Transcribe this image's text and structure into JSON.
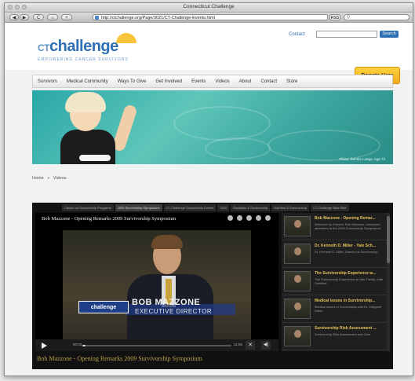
{
  "window": {
    "title": "Connecticut Challenge",
    "url": "http://ctchallenge.org/Page/3021/CT-Challenge-Events.html",
    "search_placeholder": "Q"
  },
  "toolbar": {
    "back": "◀",
    "forward": "▶",
    "reload": "C",
    "home": "⌂",
    "add": "+",
    "rss": "RSS"
  },
  "header": {
    "logo_prefix": "CT",
    "logo_main": "challenge",
    "logo_tagline": "EMPOWERING CANCER SURVIVORS",
    "contact": "Contact",
    "search_button": "Search",
    "donate": "Donate Here"
  },
  "nav": {
    "items": [
      "Survivors",
      "Medical Community",
      "Ways To Give",
      "Get Involved",
      "Events",
      "Videos",
      "About",
      "Contact",
      "Store"
    ]
  },
  "hero": {
    "credit": "Photo: Bonnie Longo, Age 72"
  },
  "breadcrumb": {
    "home": "Home",
    "sep": "»",
    "current": "Videos"
  },
  "video": {
    "tabs": [
      "Callout on Survivorship Programs",
      "2009 Survivorship Symposium",
      "CT Challenge Survivorship Events",
      "2010",
      "Radiation & Survivorship",
      "Nutrition & Survivorship",
      "CT Challenge Bike Ride"
    ],
    "title": "Bob Mazzone - Opening Remarks 2009 Survivorship Symposium",
    "lower_third_logo": "challenge",
    "lower_third_name": "BOB MAZZONE",
    "lower_third_role": "EXECUTIVE DIRECTOR",
    "time_current": "00:00",
    "time_total": "11:05",
    "progress": 0.02,
    "close": "✕",
    "volume": "◀)",
    "caption": "Bob Mazzone - Opening Remarks 2009 Survivorship Symposium"
  },
  "playlist": {
    "items": [
      {
        "title": "Bob Mazzone - Opening Remar...",
        "desc": "Welcome by Director, Bob Mazzone, welcomes attendees to the 2009 Survivorship Symposium."
      },
      {
        "title": "Dr. Kenneth D. Miller - Yale Sch...",
        "desc": "Dr. Kenneth D. Miller, Director of Survivorship."
      },
      {
        "title": "The Survivorship Experience w...",
        "desc": "The Survivorship Experience at Yale Family, Kate Gottfried."
      },
      {
        "title": "Medical Issues in Survivorship...",
        "desc": "Medical Issues in Survivorship with Dr. Margaret Davis."
      },
      {
        "title": "Survivorship Risk Assessment ...",
        "desc": "Survivorship Risk Assessment and Care."
      }
    ]
  },
  "colors": {
    "brand_blue": "#2f6fb3",
    "donate_yellow": "#ffd23d",
    "caption_gold": "#b9a24c"
  }
}
